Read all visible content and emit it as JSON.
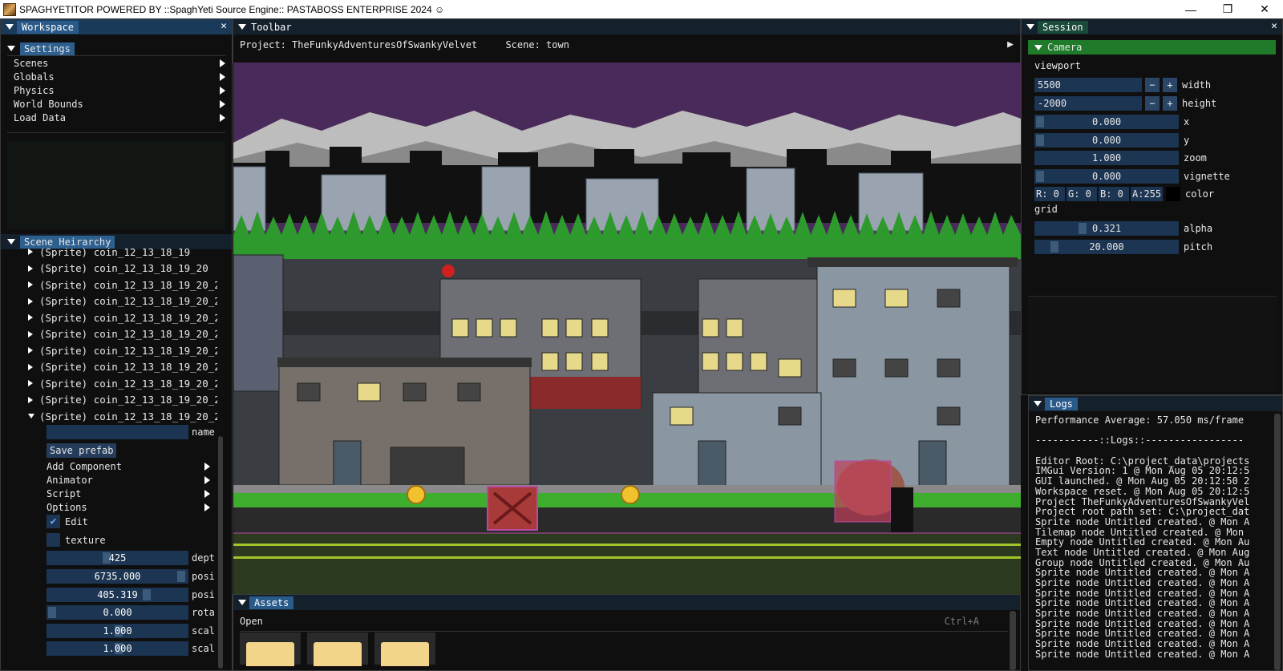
{
  "window": {
    "title": "SPAGHYETITOR POWERED BY ::SpaghYeti Source Engine:: PASTABOSS ENTERPRISE 2024 ☺",
    "minimize": "—",
    "maximize": "❐",
    "close": "✕"
  },
  "workspace": {
    "title": "Workspace",
    "settings_header": "Settings",
    "menu": [
      "Scenes",
      "Globals",
      "Physics",
      "World Bounds",
      "Load Data"
    ]
  },
  "hierarchy": {
    "title": "Scene Heirarchy",
    "items": [
      "(Sprite) coin_12_13_18_19",
      "(Sprite) coin_12_13_18_19_20",
      "(Sprite) coin_12_13_18_19_20_2",
      "(Sprite) coin_12_13_18_19_20_2",
      "(Sprite) coin_12_13_18_19_20_2",
      "(Sprite) coin_12_13_18_19_20_2",
      "(Sprite) coin_12_13_18_19_20_2",
      "(Sprite) coin_12_13_18_19_20_2",
      "(Sprite) coin_12_13_18_19_20_2",
      "(Sprite) coin_12_13_18_19_20_2",
      "(Sprite) coin_12_13_18_19_20_2"
    ],
    "name_label": "name",
    "name_value": "",
    "save_prefab": "Save prefab",
    "submenu": [
      "Add Component",
      "Animator",
      "Script",
      "Options"
    ],
    "edit_label": "Edit",
    "edit_checked": true,
    "texture_label": "texture",
    "fields": [
      {
        "value": "425",
        "label": "dept"
      },
      {
        "value": "6735.000",
        "label": "posi"
      },
      {
        "value": "405.319",
        "label": "posi"
      },
      {
        "value": "0.000",
        "label": "rota"
      },
      {
        "value": "1.000",
        "label": "scal"
      },
      {
        "value": "1.000",
        "label": "scal"
      }
    ]
  },
  "toolbar": {
    "title": "Toolbar",
    "project_label": "Project: TheFunkyAdventuresOfSwankyVelvet",
    "scene_label": "Scene: town",
    "play_icon": "▶"
  },
  "assets": {
    "title": "Assets",
    "open_label": "Open",
    "shortcut": "Ctrl+A"
  },
  "session": {
    "title": "Session",
    "camera_header": "Camera",
    "viewport_label": "viewport",
    "width_value": "5500",
    "width_label": "width",
    "height_value": "-2000",
    "height_label": "height",
    "minus": "−",
    "plus": "+",
    "x_value": "0.000",
    "x_label": "x",
    "y_value": "0.000",
    "y_label": "y",
    "zoom_value": "1.000",
    "zoom_label": "zoom",
    "vignette_value": "0.000",
    "vignette_label": "vignette",
    "color_r": "R:  0",
    "color_g": "G:  0",
    "color_b": "B:  0",
    "color_a": "A:255",
    "color_label": "color",
    "grid_label": "grid",
    "alpha_value": "0.321",
    "alpha_label": "alpha",
    "pitch_value": "20.000",
    "pitch_label": "pitch"
  },
  "logs": {
    "title": "Logs",
    "lines": [
      "Performance Average: 57.050 ms/frame",
      "",
      "-----------::Logs::-----------------",
      "",
      "Editor Root: C:\\project_data\\projects",
      "IMGui Version: 1 @ Mon Aug 05 20:12:5",
      "GUI launched. @ Mon Aug 05 20:12:50 2",
      "Workspace reset. @ Mon Aug 05 20:12:5",
      "Project TheFunkyAdventuresOfSwankyVel",
      "Project root path set: C:\\project_dat",
      "Sprite node Untitled created. @ Mon A",
      "Tilemap node Untitled created. @ Mon",
      "Empty node Untitled created. @ Mon Au",
      "Text node Untitled created. @ Mon Aug",
      "Group node Untitled created. @ Mon Au",
      "Sprite node Untitled created. @ Mon A",
      "Sprite node Untitled created. @ Mon A",
      "Sprite node Untitled created. @ Mon A",
      "Sprite node Untitled created. @ Mon A",
      "Sprite node Untitled created. @ Mon A",
      "Sprite node Untitled created. @ Mon A",
      "Sprite node Untitled created. @ Mon A",
      "Sprite node Untitled created. @ Mon A",
      "Sprite node Untitled created. @ Mon A"
    ]
  },
  "colors": {
    "panel_title": "#1a3a5a",
    "header": "#2d5f8f",
    "camera_header": "#1f7a2a",
    "sky": "#4a2a5a",
    "grass": "#3fae2f"
  }
}
